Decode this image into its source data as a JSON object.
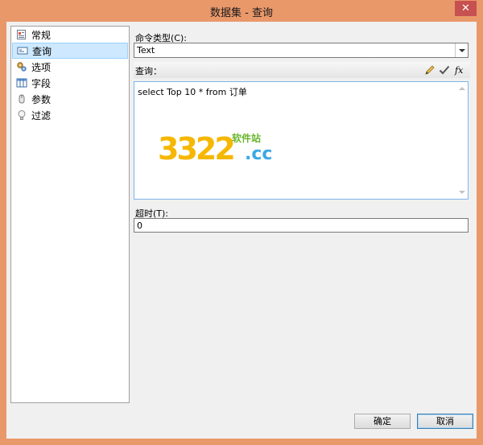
{
  "window": {
    "title": "数据集 - 查询",
    "close_glyph": "✕"
  },
  "nav": {
    "items": [
      {
        "label": "常规",
        "icon": "general-icon",
        "selected": false
      },
      {
        "label": "查询",
        "icon": "query-icon",
        "selected": true
      },
      {
        "label": "选项",
        "icon": "options-icon",
        "selected": false
      },
      {
        "label": "字段",
        "icon": "fields-icon",
        "selected": false
      },
      {
        "label": "参数",
        "icon": "parameters-icon",
        "selected": false
      },
      {
        "label": "过滤",
        "icon": "filter-icon",
        "selected": false
      }
    ]
  },
  "command_type": {
    "label": "命令类型(C):",
    "value": "Text"
  },
  "query": {
    "label": "查询：",
    "text": "select Top 10 * from 订单"
  },
  "timeout": {
    "label": "超时(T):",
    "value": "0"
  },
  "buttons": {
    "ok": "确定",
    "cancel": "取消"
  },
  "watermark": {
    "digits": "3322",
    "suffix": ".cc",
    "site": "软件站"
  },
  "colors": {
    "title_bar": "#e9986a",
    "selection": "#cde8ff",
    "editor_border": "#7eb4ea"
  }
}
